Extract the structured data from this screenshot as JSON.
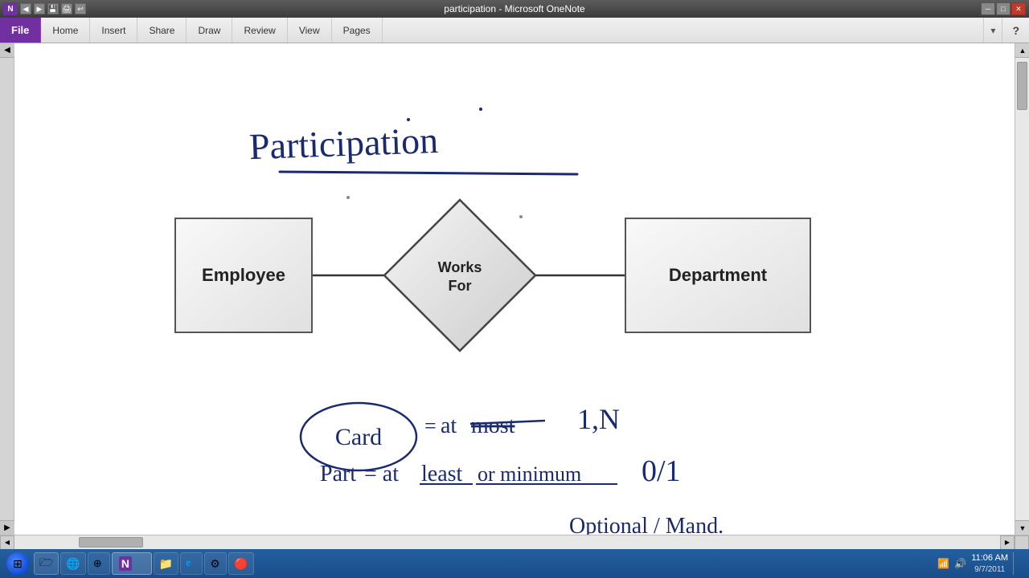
{
  "window": {
    "title": "participation - Microsoft OneNote",
    "title_bar_close": "✕",
    "title_bar_max": "□",
    "title_bar_min": "─"
  },
  "ribbon": {
    "tabs": [
      "File",
      "Home",
      "Insert",
      "Share",
      "Draw",
      "Review",
      "View",
      "Pages"
    ],
    "active_tab": "File",
    "dropdown_arrow": "▾",
    "help": "?"
  },
  "diagram": {
    "title": "Participation",
    "entities": [
      {
        "id": "employee",
        "label": "Employee"
      },
      {
        "id": "department",
        "label": "Department"
      }
    ],
    "relationship": {
      "label": "Works For"
    }
  },
  "taskbar": {
    "items": [
      {
        "name": "explorer",
        "icon": "🗁"
      },
      {
        "name": "firefox",
        "icon": "🦊"
      },
      {
        "name": "globe",
        "icon": "🌐"
      },
      {
        "name": "onenote",
        "icon": "N"
      },
      {
        "name": "usb",
        "icon": "💾"
      },
      {
        "name": "ie",
        "icon": "e"
      },
      {
        "name": "settings",
        "icon": "⚙"
      },
      {
        "name": "app2",
        "icon": "🔴"
      }
    ],
    "systray": {
      "time": "11:06 AM",
      "date": "9/7/2011"
    }
  },
  "scrollbars": {
    "left_arrow": "◀",
    "right_arrow": "▶",
    "up_arrow": "▲",
    "down_arrow": "▼"
  }
}
